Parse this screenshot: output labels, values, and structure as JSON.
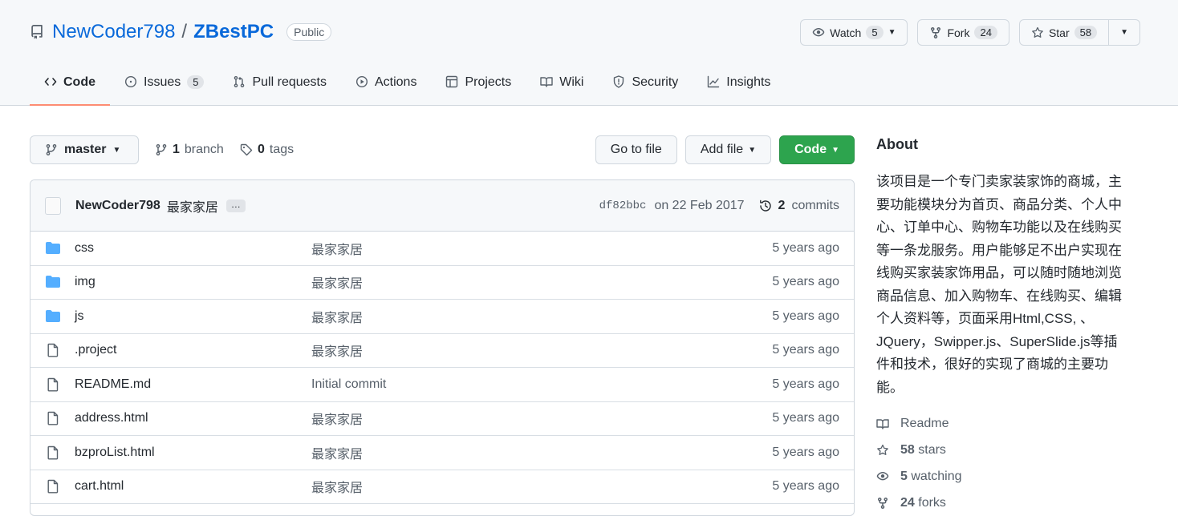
{
  "header": {
    "owner": "NewCoder798",
    "slash": "/",
    "repo": "ZBestPC",
    "visibility": "Public",
    "watch": {
      "label": "Watch",
      "count": "5"
    },
    "fork": {
      "label": "Fork",
      "count": "24"
    },
    "star": {
      "label": "Star",
      "count": "58"
    }
  },
  "tabs": [
    {
      "label": "Code",
      "icon": "code-icon"
    },
    {
      "label": "Issues",
      "icon": "issue-icon",
      "count": "5"
    },
    {
      "label": "Pull requests",
      "icon": "pull-request-icon"
    },
    {
      "label": "Actions",
      "icon": "play-icon"
    },
    {
      "label": "Projects",
      "icon": "table-icon"
    },
    {
      "label": "Wiki",
      "icon": "book-icon"
    },
    {
      "label": "Security",
      "icon": "shield-icon"
    },
    {
      "label": "Insights",
      "icon": "graph-icon"
    }
  ],
  "branch_bar": {
    "branch": "master",
    "branch_count": "1",
    "branch_label": "branch",
    "tag_count": "0",
    "tag_label": "tags",
    "go_to_file": "Go to file",
    "add_file": "Add file",
    "code": "Code"
  },
  "commit": {
    "author": "NewCoder798",
    "message": "最家家居",
    "ellipsis": "…",
    "sha": "df82bbc",
    "date": "on 22 Feb 2017",
    "commit_count": "2",
    "commit_label": "commits"
  },
  "files": [
    {
      "type": "dir",
      "name": "css",
      "message": "最家家居",
      "age": "5 years ago"
    },
    {
      "type": "dir",
      "name": "img",
      "message": "最家家居",
      "age": "5 years ago"
    },
    {
      "type": "dir",
      "name": "js",
      "message": "最家家居",
      "age": "5 years ago"
    },
    {
      "type": "file",
      "name": ".project",
      "message": "最家家居",
      "age": "5 years ago"
    },
    {
      "type": "file",
      "name": "README.md",
      "message": "Initial commit",
      "age": "5 years ago"
    },
    {
      "type": "file",
      "name": "address.html",
      "message": "最家家居",
      "age": "5 years ago"
    },
    {
      "type": "file",
      "name": "bzproList.html",
      "message": "最家家居",
      "age": "5 years ago"
    },
    {
      "type": "file",
      "name": "cart.html",
      "message": "最家家居",
      "age": "5 years ago"
    }
  ],
  "about": {
    "heading": "About",
    "description_lines": [
      "该项目是一个专门卖家装家饰的商城，主",
      "要功能模块分为首页、商品分类、个人中",
      "心、订单中心、购物车功能以及在线购买",
      "等一条龙服务。用户能够足不出户实现在",
      "线购买家装家饰用品，可以随时随地浏览",
      "商品信息、加入购物车、在线购买、编辑",
      "个人资料等，页面采用Html,CSS, 、",
      "JQuery，Swipper.js、SuperSlide.js等插",
      "件和技术，很好的实现了商城的主要功",
      "能。"
    ],
    "readme": "Readme",
    "stars_count": "58",
    "stars_label": "stars",
    "watching_count": "5",
    "watching_label": "watching",
    "forks_count": "24",
    "forks_label": "forks"
  },
  "colors": {
    "link": "#0969da",
    "green_button": "#2da44e",
    "active_tab_underline": "#fd8c73",
    "folder": "#54aeff"
  }
}
